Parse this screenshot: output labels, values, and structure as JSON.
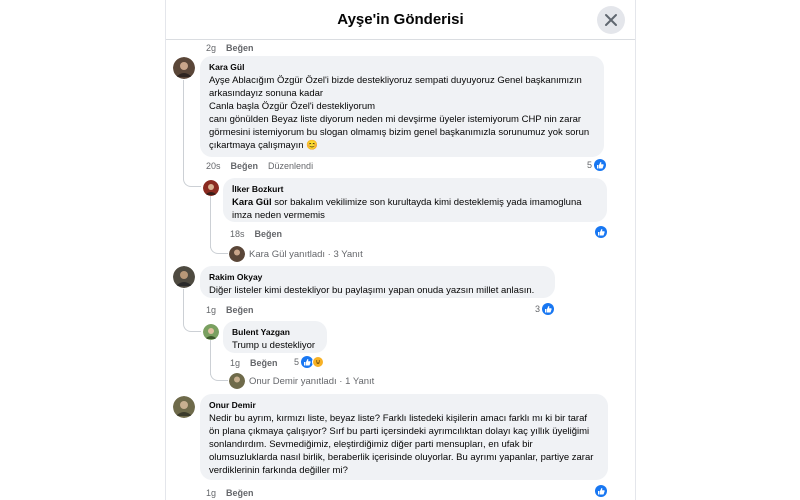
{
  "modal": {
    "title": "Ayşe'in Gönderisi"
  },
  "top_meta": {
    "time": "2g",
    "like": "Beğen"
  },
  "comments": [
    {
      "author": "Kara Gül",
      "text": "Ayşe Ablacığım Özgür Özel'i bizde destekliyoruz sempati duyuyoruz Genel başkanımızın arkasındayız sonuna kadar\nCanla başla Özgür Özel'i destekliyorum\ncanı gönülden Beyaz liste diyorum neden mi devşirme üyeler istemiyorum CHP nin zarar görmesini istemiyorum bu slogan olmamış bizim genel başkanımızla sorunumuz yok sorun çıkartmaya çalışmayın",
      "emoji": "😊",
      "time": "20s",
      "like": "Beğen",
      "edited": "Düzenlendi",
      "reactions": "5",
      "reply": {
        "author": "İlker Bozkurt",
        "mention": "Kara Gül",
        "text": " sor bakalım vekilimize son kurultayda kimi desteklemiş yada imamogluna imza neden vermemis",
        "time": "18s",
        "like": "Beğen"
      },
      "replies_link": "Kara Gül yanıtladı · 3 Yanıt"
    },
    {
      "author": "Rakim Okyay",
      "text": "Diğer listeler kimi destekliyor bu paylaşımı yapan onuda yazsın millet anlasın.",
      "time": "1g",
      "like": "Beğen",
      "reactions": "3",
      "reply": {
        "author": "Bulent Yazgan",
        "text": "Trump u destekliyor",
        "time": "1g",
        "like": "Beğen",
        "reactions": "5"
      },
      "replies_link": "Onur Demir yanıtladı · 1 Yanıt"
    },
    {
      "author": "Onur Demir",
      "text": "Nedir bu ayrım, kırmızı liste, beyaz liste? Farklı listedeki kişilerin amacı farklı mı ki bir taraf ön plana çıkmaya çalışıyor? Sırf bu parti içersindeki ayrımcılıktan dolayı kaç yıllık üyeliğimi sonlandırdım. Sevmediğimiz, eleştirdiğimiz diğer parti mensupları, en ufak bir olumsuzluklarda nasıl birlik, beraberlik içerisinde oluyorlar. Bu ayrımı yapanlar, partiye zarar verdiklerinin farkında değiller mi?",
      "time": "1g",
      "like": "Beğen"
    }
  ],
  "colors": {
    "accent": "#1877f2",
    "bubble": "#f0f2f5",
    "muted": "#65676b"
  }
}
